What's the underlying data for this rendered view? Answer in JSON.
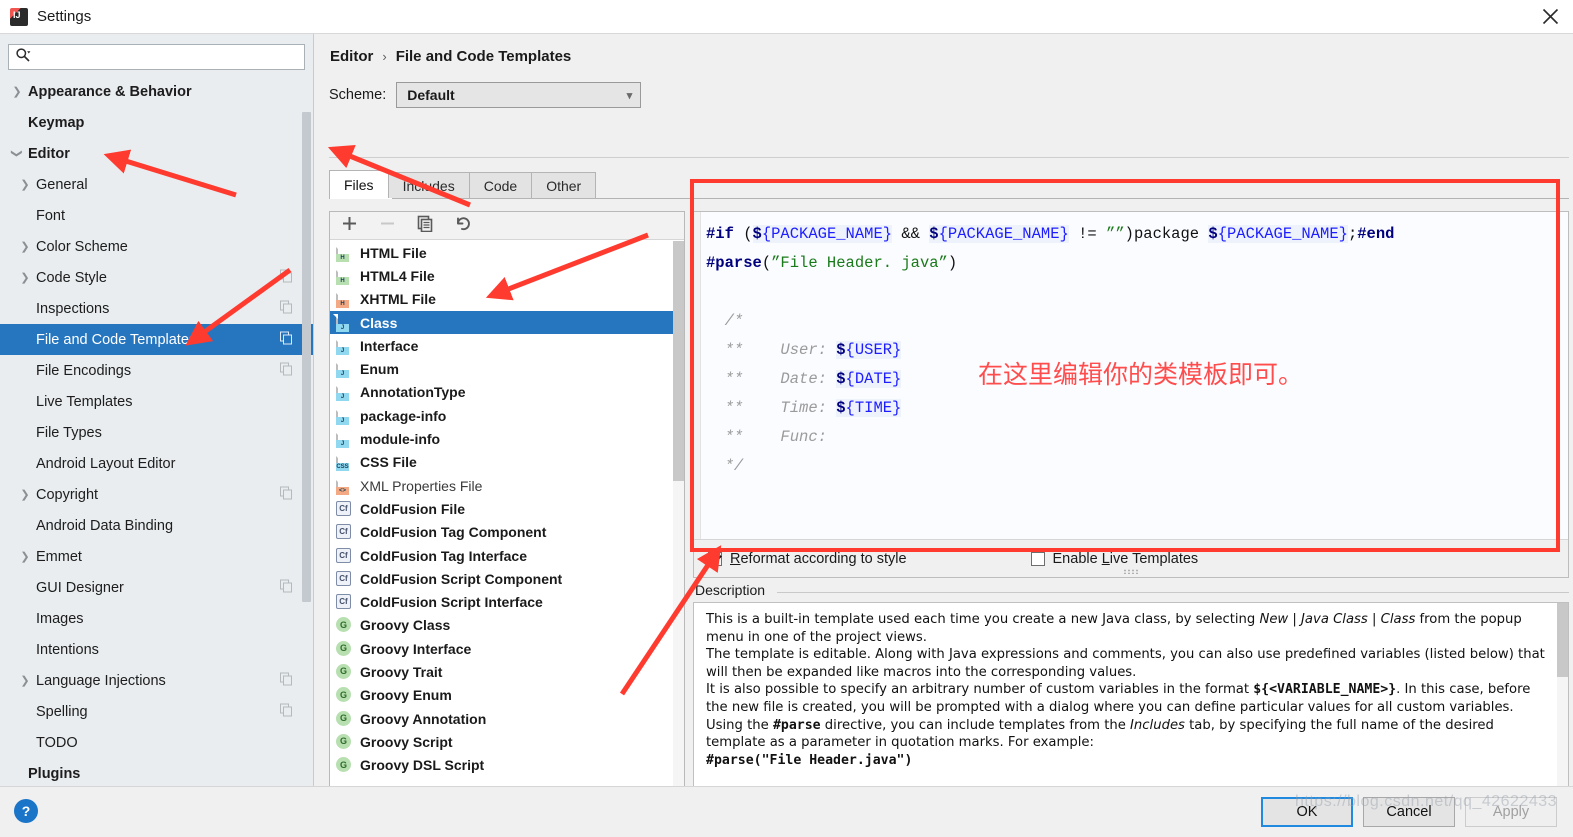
{
  "window": {
    "title": "Settings",
    "app_icon": "intellij-idea-icon",
    "close_icon": "close-icon"
  },
  "search": {
    "placeholder": "",
    "value": "",
    "icon": "search-icon"
  },
  "sidebar": {
    "items": [
      {
        "label": "Appearance & Behavior",
        "level": 0,
        "arrow": "chevron-right",
        "copy": false,
        "selected": false
      },
      {
        "label": "Keymap",
        "level": 0,
        "arrow": "",
        "copy": false,
        "selected": false
      },
      {
        "label": "Editor",
        "level": 0,
        "arrow": "chevron-down",
        "copy": false,
        "selected": false
      },
      {
        "label": "General",
        "level": 1,
        "arrow": "chevron-right",
        "copy": false,
        "selected": false
      },
      {
        "label": "Font",
        "level": 1,
        "arrow": "",
        "copy": false,
        "selected": false
      },
      {
        "label": "Color Scheme",
        "level": 1,
        "arrow": "chevron-right",
        "copy": false,
        "selected": false
      },
      {
        "label": "Code Style",
        "level": 1,
        "arrow": "chevron-right",
        "copy": true,
        "selected": false
      },
      {
        "label": "Inspections",
        "level": 1,
        "arrow": "",
        "copy": true,
        "selected": false
      },
      {
        "label": "File and Code Templates",
        "level": 1,
        "arrow": "",
        "copy": true,
        "selected": true
      },
      {
        "label": "File Encodings",
        "level": 1,
        "arrow": "",
        "copy": true,
        "selected": false
      },
      {
        "label": "Live Templates",
        "level": 1,
        "arrow": "",
        "copy": false,
        "selected": false
      },
      {
        "label": "File Types",
        "level": 1,
        "arrow": "",
        "copy": false,
        "selected": false
      },
      {
        "label": "Android Layout Editor",
        "level": 1,
        "arrow": "",
        "copy": false,
        "selected": false
      },
      {
        "label": "Copyright",
        "level": 1,
        "arrow": "chevron-right",
        "copy": true,
        "selected": false
      },
      {
        "label": "Android Data Binding",
        "level": 1,
        "arrow": "",
        "copy": false,
        "selected": false
      },
      {
        "label": "Emmet",
        "level": 1,
        "arrow": "chevron-right",
        "copy": false,
        "selected": false
      },
      {
        "label": "GUI Designer",
        "level": 1,
        "arrow": "",
        "copy": true,
        "selected": false
      },
      {
        "label": "Images",
        "level": 1,
        "arrow": "",
        "copy": false,
        "selected": false
      },
      {
        "label": "Intentions",
        "level": 1,
        "arrow": "",
        "copy": false,
        "selected": false
      },
      {
        "label": "Language Injections",
        "level": 1,
        "arrow": "chevron-right",
        "copy": true,
        "selected": false
      },
      {
        "label": "Spelling",
        "level": 1,
        "arrow": "",
        "copy": true,
        "selected": false
      },
      {
        "label": "TODO",
        "level": 1,
        "arrow": "",
        "copy": false,
        "selected": false
      },
      {
        "label": "Plugins",
        "level": 0,
        "arrow": "",
        "copy": false,
        "selected": false
      }
    ]
  },
  "breadcrumb": {
    "parent": "Editor",
    "separator": "›",
    "current": "File and Code Templates"
  },
  "scheme": {
    "label": "Scheme:",
    "value": "Default",
    "chevron": "chevron-down-icon"
  },
  "tabs": [
    {
      "label": "Files",
      "active": true
    },
    {
      "label": "Includes",
      "active": false
    },
    {
      "label": "Code",
      "active": false
    },
    {
      "label": "Other",
      "active": false
    }
  ],
  "list_toolbar": [
    {
      "name": "add-template-button",
      "glyph": "plus-icon",
      "disabled": false
    },
    {
      "name": "remove-template-button",
      "glyph": "minus-icon",
      "disabled": true
    },
    {
      "name": "copy-template-button",
      "glyph": "copy-icon",
      "disabled": false
    },
    {
      "name": "reset-template-button",
      "glyph": "revert-icon",
      "disabled": false
    }
  ],
  "templates": [
    {
      "label": "HTML File",
      "icon": "html-file-icon",
      "icon_kind": "doc",
      "tag": "H",
      "tag_bg": "#b7dfb0",
      "selected": false,
      "dim": false
    },
    {
      "label": "HTML4 File",
      "icon": "html4-file-icon",
      "icon_kind": "doc",
      "tag": "H",
      "tag_bg": "#b7dfb0",
      "selected": false,
      "dim": false
    },
    {
      "label": "XHTML File",
      "icon": "xhtml-file-icon",
      "icon_kind": "doc",
      "tag": "H",
      "tag_bg": "#f3a983",
      "selected": false,
      "dim": false
    },
    {
      "label": "Class",
      "icon": "java-class-icon",
      "icon_kind": "doc",
      "tag": "J",
      "tag_bg": "#8fd8ef",
      "selected": true,
      "dim": false
    },
    {
      "label": "Interface",
      "icon": "java-interface-icon",
      "icon_kind": "doc",
      "tag": "J",
      "tag_bg": "#8fd8ef",
      "selected": false,
      "dim": false
    },
    {
      "label": "Enum",
      "icon": "java-enum-icon",
      "icon_kind": "doc",
      "tag": "J",
      "tag_bg": "#8fd8ef",
      "selected": false,
      "dim": false
    },
    {
      "label": "AnnotationType",
      "icon": "java-annotation-icon",
      "icon_kind": "doc",
      "tag": "J",
      "tag_bg": "#8fd8ef",
      "selected": false,
      "dim": false
    },
    {
      "label": "package-info",
      "icon": "java-package-info-icon",
      "icon_kind": "doc",
      "tag": "J",
      "tag_bg": "#8fd8ef",
      "selected": false,
      "dim": false
    },
    {
      "label": "module-info",
      "icon": "java-module-info-icon",
      "icon_kind": "doc",
      "tag": "J",
      "tag_bg": "#8fd8ef",
      "selected": false,
      "dim": false
    },
    {
      "label": "CSS File",
      "icon": "css-file-icon",
      "icon_kind": "doc",
      "tag": "CSS",
      "tag_bg": "#8fd8ef",
      "selected": false,
      "dim": false
    },
    {
      "label": "XML Properties File",
      "icon": "xml-properties-file-icon",
      "icon_kind": "doc",
      "tag": "<>",
      "tag_bg": "#f3a983",
      "selected": false,
      "dim": true
    },
    {
      "label": "ColdFusion File",
      "icon": "coldfusion-file-icon",
      "icon_kind": "square",
      "tag": "Cf",
      "tag_bg": "#eef1f7",
      "selected": false,
      "dim": false
    },
    {
      "label": "ColdFusion Tag Component",
      "icon": "coldfusion-tag-component-icon",
      "icon_kind": "square",
      "tag": "Cf",
      "tag_bg": "#eef1f7",
      "selected": false,
      "dim": false
    },
    {
      "label": "ColdFusion Tag Interface",
      "icon": "coldfusion-tag-interface-icon",
      "icon_kind": "square",
      "tag": "Cf",
      "tag_bg": "#eef1f7",
      "selected": false,
      "dim": false
    },
    {
      "label": "ColdFusion Script Component",
      "icon": "coldfusion-script-component-icon",
      "icon_kind": "square",
      "tag": "Cf",
      "tag_bg": "#eef1f7",
      "selected": false,
      "dim": false
    },
    {
      "label": "ColdFusion Script Interface",
      "icon": "coldfusion-script-interface-icon",
      "icon_kind": "square",
      "tag": "Cf",
      "tag_bg": "#eef1f7",
      "selected": false,
      "dim": false
    },
    {
      "label": "Groovy Class",
      "icon": "groovy-class-icon",
      "icon_kind": "circle",
      "tag": "G",
      "tag_bg": "#b7dfb0",
      "selected": false,
      "dim": false
    },
    {
      "label": "Groovy Interface",
      "icon": "groovy-interface-icon",
      "icon_kind": "circle",
      "tag": "G",
      "tag_bg": "#b7dfb0",
      "selected": false,
      "dim": false
    },
    {
      "label": "Groovy Trait",
      "icon": "groovy-trait-icon",
      "icon_kind": "circle",
      "tag": "G",
      "tag_bg": "#b7dfb0",
      "selected": false,
      "dim": false
    },
    {
      "label": "Groovy Enum",
      "icon": "groovy-enum-icon",
      "icon_kind": "circle",
      "tag": "G",
      "tag_bg": "#b7dfb0",
      "selected": false,
      "dim": false
    },
    {
      "label": "Groovy Annotation",
      "icon": "groovy-annotation-icon",
      "icon_kind": "circle",
      "tag": "G",
      "tag_bg": "#b7dfb0",
      "selected": false,
      "dim": false
    },
    {
      "label": "Groovy Script",
      "icon": "groovy-script-icon",
      "icon_kind": "circle",
      "tag": "G",
      "tag_bg": "#b7dfb0",
      "selected": false,
      "dim": false
    },
    {
      "label": "Groovy DSL Script",
      "icon": "groovy-dsl-script-icon",
      "icon_kind": "circle",
      "tag": "G",
      "tag_bg": "#b7dfb0",
      "selected": false,
      "dim": false
    }
  ],
  "editor": {
    "lines": [
      [
        {
          "t": "#if",
          "c": "dir"
        },
        {
          "t": " (",
          "c": "plain"
        },
        {
          "t": "$",
          "c": "dollar"
        },
        {
          "t": "{PACKAGE_NAME}",
          "c": "var"
        },
        {
          "t": " && ",
          "c": "plain"
        },
        {
          "t": "$",
          "c": "dollar"
        },
        {
          "t": "{PACKAGE_NAME}",
          "c": "var"
        },
        {
          "t": " != ",
          "c": "plain"
        },
        {
          "t": "””",
          "c": "str"
        },
        {
          "t": ")",
          "c": "plain"
        },
        {
          "t": "package ",
          "c": "plain"
        },
        {
          "t": "$",
          "c": "dollar"
        },
        {
          "t": "{PACKAGE_NAME}",
          "c": "var"
        },
        {
          "t": ";",
          "c": "plain"
        },
        {
          "t": "#end",
          "c": "dir"
        }
      ],
      [
        {
          "t": "#parse",
          "c": "dir"
        },
        {
          "t": "(",
          "c": "plain"
        },
        {
          "t": "”File Header. java”",
          "c": "str"
        },
        {
          "t": ")",
          "c": "plain"
        }
      ],
      [],
      [
        {
          "t": "  /*",
          "c": "cmt"
        }
      ],
      [
        {
          "t": "  **    User: ",
          "c": "cmt"
        },
        {
          "t": "$",
          "c": "dollar"
        },
        {
          "t": "{USER}",
          "c": "var"
        }
      ],
      [
        {
          "t": "  **    Date: ",
          "c": "cmt"
        },
        {
          "t": "$",
          "c": "dollar"
        },
        {
          "t": "{DATE}",
          "c": "var"
        }
      ],
      [
        {
          "t": "  **    Time: ",
          "c": "cmt"
        },
        {
          "t": "$",
          "c": "dollar"
        },
        {
          "t": "{TIME}",
          "c": "var"
        }
      ],
      [
        {
          "t": "  **    Func:",
          "c": "cmt"
        }
      ],
      [
        {
          "t": "  */",
          "c": "cmt"
        }
      ]
    ]
  },
  "options": {
    "reformat": {
      "label": "Reformat according to style",
      "underline_index": 0,
      "checked": true
    },
    "live_templates": {
      "label": "Enable Live Templates",
      "underline_index": 7,
      "checked": false
    }
  },
  "description": {
    "legend": "Description",
    "paragraphs": [
      {
        "type": "rich",
        "parts": [
          {
            "t": "This is a built-in template used each time you create a new Java class, by selecting ",
            "s": ""
          },
          {
            "t": "New",
            "s": "i"
          },
          {
            "t": " | ",
            "s": ""
          },
          {
            "t": "Java Class",
            "s": "i"
          },
          {
            "t": " | ",
            "s": ""
          },
          {
            "t": "Class",
            "s": "i"
          },
          {
            "t": " from the popup menu in one of the project views.",
            "s": ""
          }
        ]
      },
      {
        "type": "rich",
        "parts": [
          {
            "t": "The template is editable. Along with Java expressions and comments, you can also use predefined variables (listed below) that will then be expanded like macros into the corresponding values.",
            "s": ""
          }
        ]
      },
      {
        "type": "rich",
        "parts": [
          {
            "t": "It is also possible to specify an arbitrary number of custom variables in the format ",
            "s": ""
          },
          {
            "t": "${<VARIABLE_NAME>}",
            "s": "mono"
          },
          {
            "t": ". In this case, before the new file is created, you will be prompted with a dialog where you can define particular values for all custom variables.",
            "s": ""
          }
        ]
      },
      {
        "type": "rich",
        "parts": [
          {
            "t": "Using the ",
            "s": ""
          },
          {
            "t": "#parse",
            "s": "mono"
          },
          {
            "t": " directive, you can include templates from the ",
            "s": ""
          },
          {
            "t": "Includes",
            "s": "i"
          },
          {
            "t": " tab, by specifying the full name of the desired template as a parameter in quotation marks. For example:",
            "s": ""
          }
        ]
      },
      {
        "type": "rich",
        "parts": [
          {
            "t": "#parse(\"File Header.java\")",
            "s": "mono"
          }
        ]
      }
    ]
  },
  "footer": {
    "help_icon": "help-icon",
    "help_glyph": "?",
    "buttons": [
      {
        "label": "OK",
        "state": "primary"
      },
      {
        "label": "Cancel",
        "state": "normal"
      },
      {
        "label": "Apply",
        "state": "disabled"
      }
    ]
  },
  "annotations": {
    "note_cjk": "在这里编辑你的类模板即可。",
    "accent_color": "#ff3b30",
    "watermark": "https://blog.csdn.net/qq_42622433"
  },
  "colors": {
    "selection_blue": "#2675bf",
    "annotation_red": "#ff3b30",
    "panel_bg": "#f0f0f0",
    "sidebar_bg": "#e9edf0"
  }
}
